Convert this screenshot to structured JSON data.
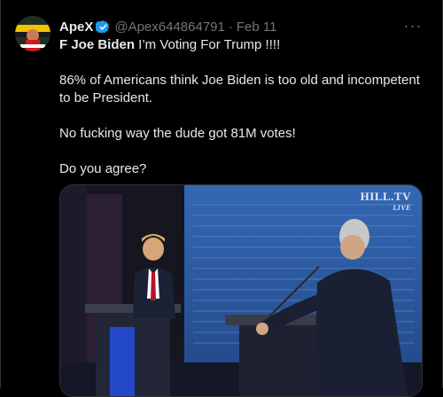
{
  "tweet": {
    "display_name": "ApeX",
    "handle": "@Apex644864791",
    "separator": "·",
    "timestamp": "Feb 11",
    "more_label": "···",
    "line1_bold": "F Joe Biden",
    "line1_rest": " I’m Voting For Trump !!!!",
    "paragraph2": "86% of Americans think Joe Biden is too old and incompetent to be President.",
    "paragraph3": "No fucking way the dude got 81M votes!",
    "paragraph4": "Do you agree?"
  },
  "media": {
    "watermark_title": "HILL.TV",
    "watermark_sub": "LIVE"
  },
  "colors": {
    "background": "#000000",
    "text": "#e7e9ea",
    "secondary": "#71767b",
    "verified": "#1d9bf0",
    "stage_blue": "#2c5ea8"
  }
}
